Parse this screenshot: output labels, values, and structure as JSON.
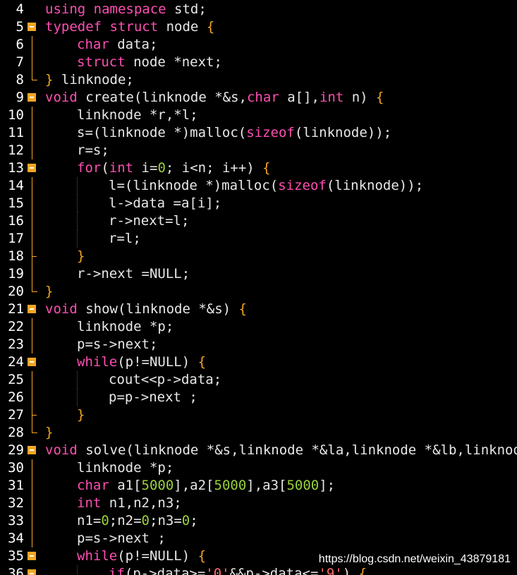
{
  "editor": {
    "lines": [
      {
        "num": "4",
        "fold": "none",
        "indent": 0,
        "tokens": [
          [
            "kw",
            "using"
          ],
          [
            "pl",
            " "
          ],
          [
            "kw",
            "namespace"
          ],
          [
            "pl",
            " std;"
          ]
        ]
      },
      {
        "num": "5",
        "fold": "open",
        "indent": 0,
        "tokens": [
          [
            "kw",
            "typedef"
          ],
          [
            "pl",
            " "
          ],
          [
            "kw",
            "struct"
          ],
          [
            "pl",
            " node "
          ],
          [
            "br",
            "{"
          ]
        ]
      },
      {
        "num": "6",
        "fold": "line",
        "indent": 1,
        "tokens": [
          [
            "kw",
            "char"
          ],
          [
            "pl",
            " data;"
          ]
        ]
      },
      {
        "num": "7",
        "fold": "line",
        "indent": 1,
        "tokens": [
          [
            "kw",
            "struct"
          ],
          [
            "pl",
            " node *next;"
          ]
        ]
      },
      {
        "num": "8",
        "fold": "end",
        "indent": 0,
        "tokens": [
          [
            "br",
            "}"
          ],
          [
            "pl",
            " linknode;"
          ]
        ]
      },
      {
        "num": "9",
        "fold": "open",
        "indent": 0,
        "tokens": [
          [
            "kw",
            "void"
          ],
          [
            "pl",
            " create(linknode *&s,"
          ],
          [
            "kw",
            "char"
          ],
          [
            "pl",
            " a[],"
          ],
          [
            "kw",
            "int"
          ],
          [
            "pl",
            " n) "
          ],
          [
            "br",
            "{"
          ]
        ]
      },
      {
        "num": "10",
        "fold": "line",
        "indent": 1,
        "tokens": [
          [
            "pl",
            "linknode *r,*l;"
          ]
        ]
      },
      {
        "num": "11",
        "fold": "line",
        "indent": 1,
        "tokens": [
          [
            "pl",
            "s=(linknode *)malloc("
          ],
          [
            "kw",
            "sizeof"
          ],
          [
            "pl",
            "(linknode));"
          ]
        ]
      },
      {
        "num": "12",
        "fold": "line",
        "indent": 1,
        "tokens": [
          [
            "pl",
            "r=s;"
          ]
        ]
      },
      {
        "num": "13",
        "fold": "open",
        "indent": 1,
        "tokens": [
          [
            "kw",
            "for"
          ],
          [
            "pl",
            "("
          ],
          [
            "kw",
            "int"
          ],
          [
            "pl",
            " i="
          ],
          [
            "num",
            "0"
          ],
          [
            "pl",
            "; i<n; i++) "
          ],
          [
            "br",
            "{"
          ]
        ]
      },
      {
        "num": "14",
        "fold": "line",
        "indent": 2,
        "tokens": [
          [
            "pl",
            "l=(linknode *)malloc("
          ],
          [
            "kw",
            "sizeof"
          ],
          [
            "pl",
            "(linknode));"
          ]
        ]
      },
      {
        "num": "15",
        "fold": "line",
        "indent": 2,
        "tokens": [
          [
            "pl",
            "l->data =a[i];"
          ]
        ]
      },
      {
        "num": "16",
        "fold": "line",
        "indent": 2,
        "tokens": [
          [
            "pl",
            "r->next=l;"
          ]
        ]
      },
      {
        "num": "17",
        "fold": "line",
        "indent": 2,
        "tokens": [
          [
            "pl",
            "r=l;"
          ]
        ]
      },
      {
        "num": "18",
        "fold": "tick",
        "indent": 1,
        "tokens": [
          [
            "br",
            "}"
          ]
        ]
      },
      {
        "num": "19",
        "fold": "line",
        "indent": 1,
        "tokens": [
          [
            "pl",
            "r->next =NULL;"
          ]
        ]
      },
      {
        "num": "20",
        "fold": "end",
        "indent": 0,
        "tokens": [
          [
            "br",
            "}"
          ]
        ]
      },
      {
        "num": "21",
        "fold": "open",
        "indent": 0,
        "tokens": [
          [
            "kw",
            "void"
          ],
          [
            "pl",
            " show(linknode *&s) "
          ],
          [
            "br",
            "{"
          ]
        ]
      },
      {
        "num": "22",
        "fold": "line",
        "indent": 1,
        "tokens": [
          [
            "pl",
            "linknode *p;"
          ]
        ]
      },
      {
        "num": "23",
        "fold": "line",
        "indent": 1,
        "tokens": [
          [
            "pl",
            "p=s->next;"
          ]
        ]
      },
      {
        "num": "24",
        "fold": "open",
        "indent": 1,
        "tokens": [
          [
            "kw",
            "while"
          ],
          [
            "pl",
            "(p!=NULL) "
          ],
          [
            "br",
            "{"
          ]
        ]
      },
      {
        "num": "25",
        "fold": "line",
        "indent": 2,
        "tokens": [
          [
            "pl",
            "cout<<p->data;"
          ]
        ]
      },
      {
        "num": "26",
        "fold": "line",
        "indent": 2,
        "tokens": [
          [
            "pl",
            "p=p->next ;"
          ]
        ]
      },
      {
        "num": "27",
        "fold": "tick",
        "indent": 1,
        "tokens": [
          [
            "br",
            "}"
          ]
        ]
      },
      {
        "num": "28",
        "fold": "end",
        "indent": 0,
        "tokens": [
          [
            "br",
            "}"
          ]
        ]
      },
      {
        "num": "29",
        "fold": "open",
        "indent": 0,
        "tokens": [
          [
            "kw",
            "void"
          ],
          [
            "pl",
            " solve(linknode *&s,linknode *&la,linknode *&lb,linknode"
          ]
        ]
      },
      {
        "num": "30",
        "fold": "line",
        "indent": 1,
        "tokens": [
          [
            "pl",
            "linknode *p;"
          ]
        ]
      },
      {
        "num": "31",
        "fold": "line",
        "indent": 1,
        "tokens": [
          [
            "kw",
            "char"
          ],
          [
            "pl",
            " a1["
          ],
          [
            "num",
            "5000"
          ],
          [
            "pl",
            "],a2["
          ],
          [
            "num",
            "5000"
          ],
          [
            "pl",
            "],a3["
          ],
          [
            "num",
            "5000"
          ],
          [
            "pl",
            "];"
          ]
        ]
      },
      {
        "num": "32",
        "fold": "line",
        "indent": 1,
        "tokens": [
          [
            "kw",
            "int"
          ],
          [
            "pl",
            " n1,n2,n3;"
          ]
        ]
      },
      {
        "num": "33",
        "fold": "line",
        "indent": 1,
        "tokens": [
          [
            "pl",
            "n1="
          ],
          [
            "num",
            "0"
          ],
          [
            "pl",
            ";n2="
          ],
          [
            "num",
            "0"
          ],
          [
            "pl",
            ";n3="
          ],
          [
            "num",
            "0"
          ],
          [
            "pl",
            ";"
          ]
        ]
      },
      {
        "num": "34",
        "fold": "line",
        "indent": 1,
        "tokens": [
          [
            "pl",
            "p=s->next ;"
          ]
        ]
      },
      {
        "num": "35",
        "fold": "open",
        "indent": 1,
        "tokens": [
          [
            "kw",
            "while"
          ],
          [
            "pl",
            "(p!=NULL) "
          ],
          [
            "br",
            "{"
          ]
        ]
      },
      {
        "num": "36",
        "fold": "open",
        "indent": 2,
        "tokens": [
          [
            "kw",
            "if"
          ],
          [
            "pl",
            "(p->data>="
          ],
          [
            "str",
            "'0'"
          ],
          [
            "pl",
            "&&p->data<="
          ],
          [
            "str",
            "'9'"
          ],
          [
            "pl",
            ") "
          ],
          [
            "br",
            "{"
          ]
        ]
      }
    ]
  },
  "watermark": "https://blog.csdn.net/weixin_43879181",
  "colors": {
    "background": "#000000",
    "keyword": "#ff4fb3",
    "number": "#9ad13b",
    "string": "#ff6a6a",
    "brace": "#f5a623",
    "plain": "#e8e8e8",
    "fold": "#f5a623"
  }
}
